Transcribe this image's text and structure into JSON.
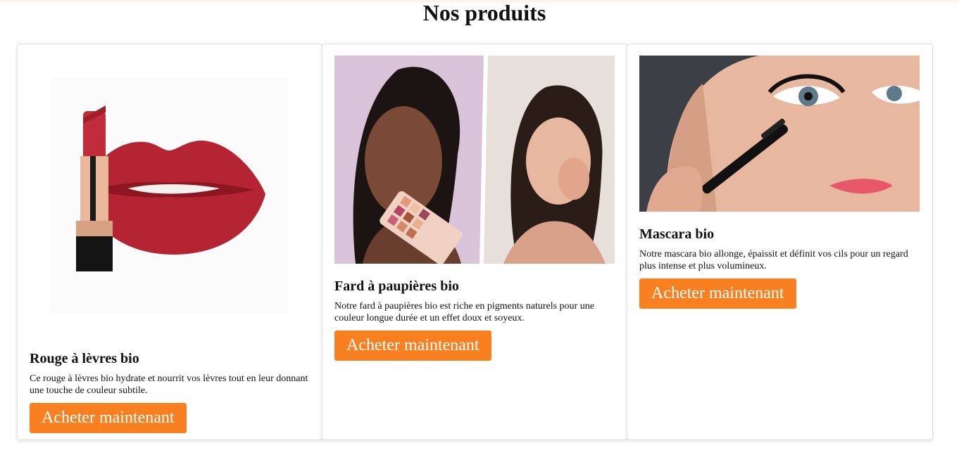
{
  "page": {
    "title": "Nos produits"
  },
  "theme": {
    "accent": "#f98020",
    "button_text": "#ffffff",
    "card_border": "#dedede"
  },
  "products": [
    {
      "name": "Rouge à lèvres bio",
      "description": "Ce rouge à lèvres bio hydrate et nourrit vos lèvres tout en leur donnant une touche de couleur subtile.",
      "button_label": "Acheter maintenant",
      "image": "lipstick-with-red-lips-photo"
    },
    {
      "name": "Fard à paupières bio",
      "description": "Notre fard à paupières bio est riche en pigments naturels pour une couleur longue durée et un effet doux et soyeux.",
      "button_label": "Acheter maintenant",
      "image": "eyeshadow-palette-models-photo"
    },
    {
      "name": "Mascara bio",
      "description": "Notre mascara bio allonge, épaissit et définit vos cils pour un regard plus intense et plus volumineux.",
      "button_label": "Acheter maintenant",
      "image": "mascara-application-photo"
    }
  ]
}
